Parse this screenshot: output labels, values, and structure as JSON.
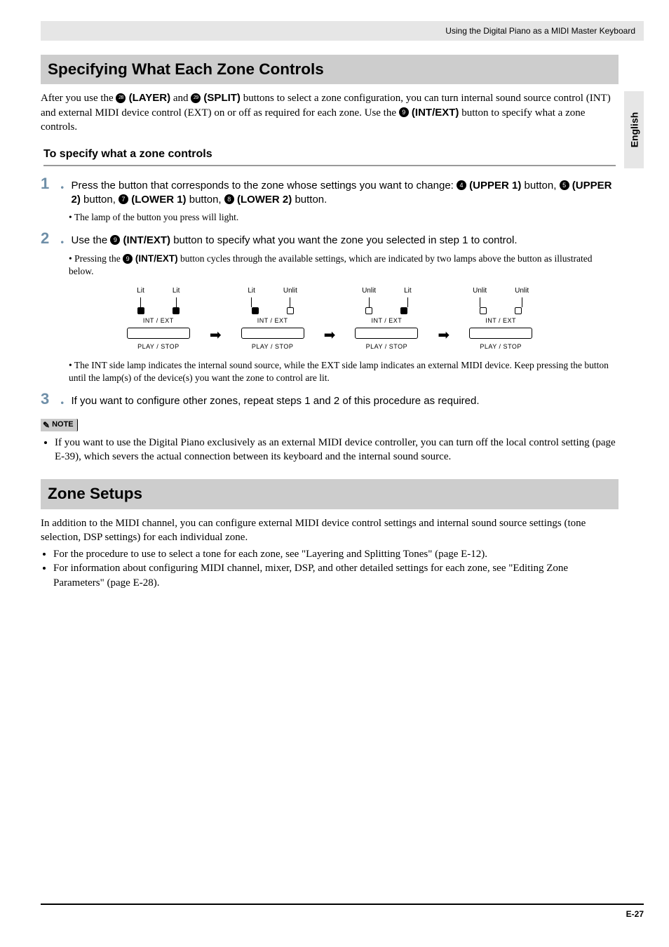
{
  "topbar": {
    "breadcrumb": "Using the Digital Piano as a MIDI Master Keyboard"
  },
  "sidetab": {
    "label": "English"
  },
  "section1": {
    "heading": "Specifying What Each Zone Controls",
    "intro_pre": "After you use the ",
    "btn28": "28",
    "layer": " (LAYER)",
    "intro_and": " and ",
    "btn29": "29",
    "split": " (SPLIT)",
    "intro_mid": " buttons to select a zone configuration, you can turn internal sound source control (INT) and external MIDI device control (EXT) on or off as required for each zone. Use the ",
    "btn9": "9",
    "intext": " (INT/EXT)",
    "intro_end": " button to specify what a zone controls.",
    "subheading": "To specify what a zone controls"
  },
  "step1": {
    "num": "1",
    "dot": ".",
    "pre": "Press the button that corresponds to the zone whose settings you want to change: ",
    "b4": "4",
    "upper1": " (UPPER 1)",
    "mid1": " button, ",
    "b5": "5",
    "upper2": " (UPPER 2)",
    "mid2": " button, ",
    "b7": "7",
    "lower1": " (LOWER 1)",
    "mid3": " button, ",
    "b8": "8",
    "lower2": " (LOWER 2)",
    "end": " button.",
    "bullet": "The lamp of the button you press will light."
  },
  "step2": {
    "num": "2",
    "dot": ".",
    "pre": "Use the ",
    "b9": "9",
    "intext": " (INT/EXT)",
    "end": " button to specify what you want the zone you selected in step 1 to control.",
    "bullet_pre": "Pressing the ",
    "bullet_b9": "9",
    "bullet_intext": " (INT/EXT)",
    "bullet_end": " button cycles through the available settings, which are indicated by two lamps above the button as illustrated below.",
    "bullet2": "The INT side lamp indicates the internal sound source, while the EXT side lamp indicates an external MIDI device. Keep pressing the button until the lamp(s) of the device(s) you want the zone to control are lit."
  },
  "diagram": {
    "lit": "Lit",
    "unlit": "Unlit",
    "intext": "INT / EXT",
    "play": "PLAY / STOP",
    "states": [
      {
        "left": "Lit",
        "right": "Lit",
        "leftOn": true,
        "rightOn": true
      },
      {
        "left": "Lit",
        "right": "Unlit",
        "leftOn": true,
        "rightOn": false
      },
      {
        "left": "Unlit",
        "right": "Lit",
        "leftOn": false,
        "rightOn": true
      },
      {
        "left": "Unlit",
        "right": "Unlit",
        "leftOn": false,
        "rightOn": false
      }
    ]
  },
  "step3": {
    "num": "3",
    "dot": ".",
    "text": "If you want to configure other zones, repeat steps 1 and 2 of this procedure as required."
  },
  "note": {
    "label": "NOTE",
    "text": "If you want to use the Digital Piano exclusively as an external MIDI device controller, you can turn off the local control setting (page E-39), which severs the actual connection between its keyboard and the internal sound source."
  },
  "section2": {
    "heading": "Zone Setups",
    "intro": "In addition to the MIDI channel, you can configure external MIDI device control settings and internal sound source settings (tone selection, DSP settings) for each individual zone.",
    "b1": "For the procedure to use to select a tone for each zone, see \"Layering and Splitting Tones\" (page E-12).",
    "b2": "For information about configuring MIDI channel, mixer, DSP, and other detailed settings for each zone, see \"Editing Zone Parameters\" (page E-28)."
  },
  "footer": {
    "page": "E-27"
  }
}
